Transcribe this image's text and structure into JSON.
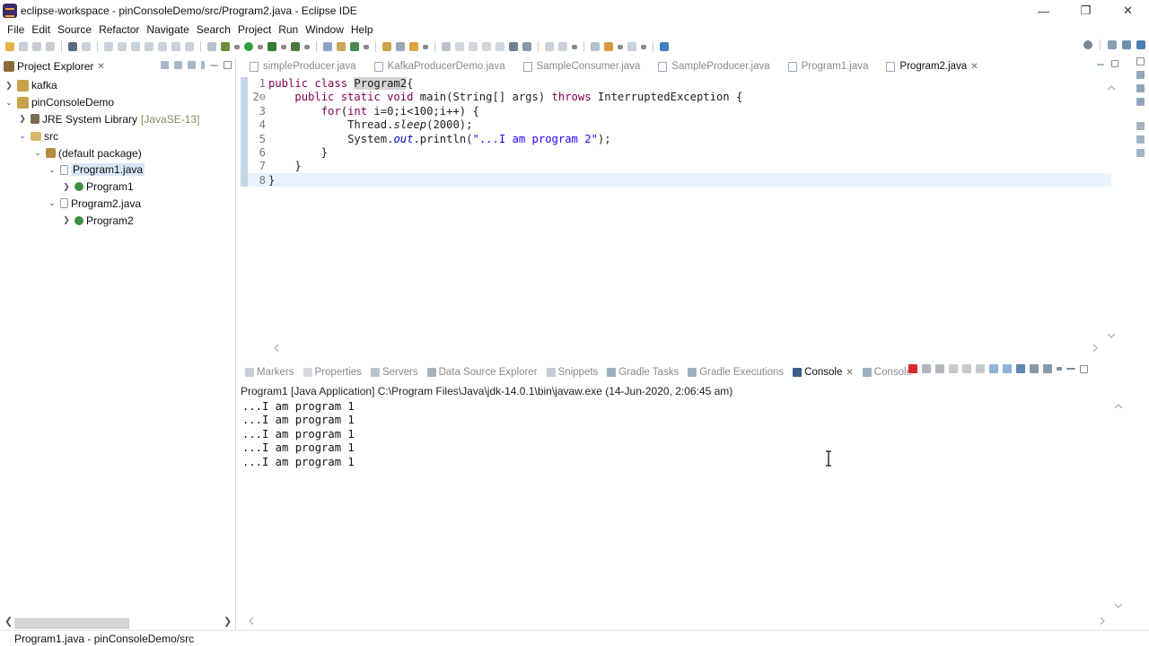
{
  "window": {
    "title": "eclipse-workspace - pinConsoleDemo/src/Program2.java - Eclipse IDE",
    "minimize": "—",
    "maximize": "❐",
    "close": "✕"
  },
  "menu": [
    "File",
    "Edit",
    "Source",
    "Refactor",
    "Navigate",
    "Search",
    "Project",
    "Run",
    "Window",
    "Help"
  ],
  "explorer": {
    "tab_label": "Project Explorer",
    "tree": {
      "kafka": "kafka",
      "project": "pinConsoleDemo",
      "jre": "JRE System Library",
      "jre_decor": "[JavaSE-13]",
      "src": "src",
      "default_package": "(default package)",
      "program1_java": "Program1.java",
      "program1_class": "Program1",
      "program2_java": "Program2.java",
      "program2_class": "Program2"
    }
  },
  "editor": {
    "tabs": [
      "simpleProducer.java",
      "KafkaProducerDemo.java",
      "SampleConsumer.java",
      "SampleProducer.java",
      "Program1.java",
      "Program2.java"
    ],
    "active_tab": "Program2.java",
    "line_numbers": [
      "1",
      "2⊖",
      "3",
      "4",
      "5",
      "6",
      "7",
      "8"
    ],
    "code": {
      "l1_kw": "public class ",
      "l1_name": "Program2",
      "l1_rest": "{",
      "l2_indent": "    ",
      "l2_kw": "public static void",
      "l2_mid": " main(String[] args) ",
      "l2_kw2": "throws",
      "l2_rest": " InterruptedException {",
      "l3_indent": "        ",
      "l3_kw": "for",
      "l3_p1": "(",
      "l3_kw2": "int",
      "l3_rest": " i=0;i<100;i++) {",
      "l4_indent": "            ",
      "l4_a": "Thread.",
      "l4_method": "sleep",
      "l4_rest": "(2000);",
      "l5_indent": "            ",
      "l5_a": "System.",
      "l5_field": "out",
      "l5_b": ".println(",
      "l5_str": "\"...I am program 2\"",
      "l5_rest": ");",
      "l6": "        }",
      "l7": "    }",
      "l8": "}"
    }
  },
  "console": {
    "tabs": [
      "Markers",
      "Properties",
      "Servers",
      "Data Source Explorer",
      "Snippets",
      "Gradle Tasks",
      "Gradle Executions",
      "Console",
      "Console"
    ],
    "active_tab_index": 7,
    "header": "Program1 [Java Application] C:\\Program Files\\Java\\jdk-14.0.1\\bin\\javaw.exe  (14-Jun-2020, 2:06:45 am)",
    "output": [
      "...I am program 1",
      "...I am program 1",
      "...I am program 1",
      "...I am program 1",
      "...I am program 1"
    ]
  },
  "status": {
    "text": "Program1.java - pinConsoleDemo/src"
  },
  "colors": {
    "keyword": "#7f0055",
    "string": "#2a00ff",
    "field": "#0000c0",
    "selection": "#d9e7f7",
    "current_line": "#e8f2fe"
  }
}
